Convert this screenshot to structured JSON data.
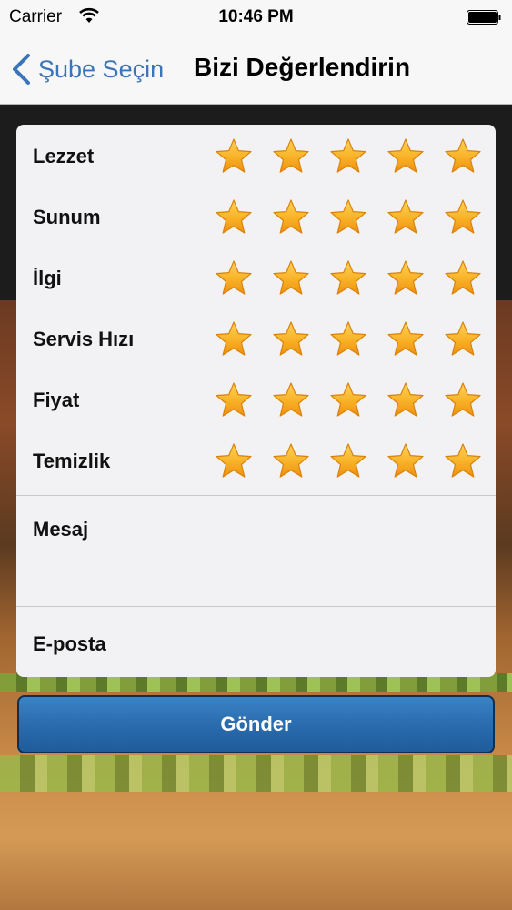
{
  "status_bar": {
    "carrier": "Carrier",
    "time": "10:46 PM"
  },
  "nav": {
    "back_label": "Şube Seçin",
    "title": "Bizi Değerlendirin"
  },
  "ratings": [
    {
      "label": "Lezzet",
      "max": 5,
      "value": 5
    },
    {
      "label": "Sunum",
      "max": 5,
      "value": 5
    },
    {
      "label": "İlgi",
      "max": 5,
      "value": 5
    },
    {
      "label": "Servis Hızı",
      "max": 5,
      "value": 5
    },
    {
      "label": "Fiyat",
      "max": 5,
      "value": 5
    },
    {
      "label": "Temizlik",
      "max": 5,
      "value": 5
    }
  ],
  "fields": {
    "message_label": "Mesaj",
    "message_value": "",
    "email_label": "E-posta",
    "email_value": ""
  },
  "send_label": "Gönder",
  "colors": {
    "accent": "#3b75b7",
    "star": "#f6a81c",
    "button": "#2a6cae"
  }
}
